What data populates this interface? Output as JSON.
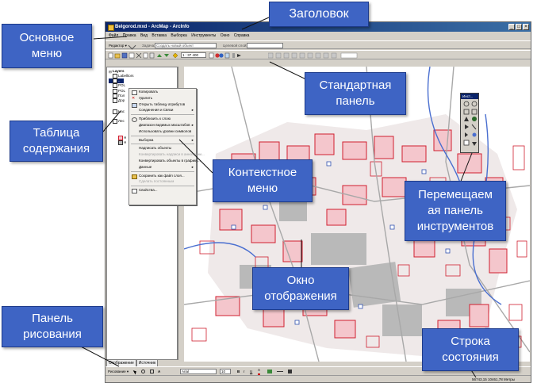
{
  "window": {
    "title": "Belgorod.mxd - ArcMap - ArcInfo",
    "controls": [
      "_",
      "□",
      "×"
    ]
  },
  "menu": [
    "Файл",
    "Правка",
    "Вид",
    "Вставка",
    "Выборка",
    "Инструменты",
    "Окно",
    "Справка"
  ],
  "editor_toolbar": {
    "editor_label": "Редактор ▾",
    "task_label": "Задача:",
    "task_value": "Создать новый объект",
    "target_label": "Целевой слой:"
  },
  "standard_toolbar": {
    "scale": "1 : 37 400"
  },
  "toc": {
    "root_label": "Layers",
    "items": [
      "Labelltors",
      "..",
      "POL",
      "POL",
      "Пол",
      "Дор",
      "Нас",
      "Лес",
      "Н",
      "Н"
    ],
    "tabs": [
      "Отображение",
      "Источник"
    ]
  },
  "context_menu": {
    "items": [
      {
        "label": "Копировать",
        "enabled": true
      },
      {
        "label": "Удалить",
        "enabled": true
      },
      {
        "label": "Открыть таблицу атрибутов",
        "enabled": true
      },
      {
        "label": "Соединения и Связи",
        "enabled": true,
        "submenu": true
      },
      {
        "label": "Приблизить к слою",
        "enabled": true
      },
      {
        "label": "Диапазон видимых масштабов",
        "enabled": true,
        "submenu": true
      },
      {
        "label": "Использовать уровни символов",
        "enabled": true
      },
      {
        "label": "Выборка",
        "enabled": true,
        "submenu": true
      },
      {
        "label": "Надписать объекты",
        "enabled": true
      },
      {
        "label": "Конвертировать надписи в аннотации...",
        "enabled": false
      },
      {
        "label": "Конвертировать объекты в графику...",
        "enabled": true
      },
      {
        "label": "Данные",
        "enabled": true,
        "submenu": true
      },
      {
        "label": "Сохранить как файл слоя...",
        "enabled": true
      },
      {
        "label": "Сделать постоянным",
        "enabled": false
      },
      {
        "label": "Свойства...",
        "enabled": true
      }
    ]
  },
  "tools_palette": {
    "title": "Инст..."
  },
  "drawing_toolbar": {
    "draw_label": "Рисование ▾",
    "font": "Arial",
    "font_size": "10",
    "bold": "B",
    "italic": "I",
    "underline": "U",
    "font_color": "A"
  },
  "status_bar": {
    "coordinates": "56743,15  10461,78 Метры"
  },
  "callouts": {
    "title": [
      "Заголовок"
    ],
    "main_menu": [
      "Основное",
      "меню"
    ],
    "standard_panel": [
      "Стандартная",
      "панель"
    ],
    "toc": [
      "Таблица",
      "содержания"
    ],
    "context_menu": [
      "Контекстное",
      "меню"
    ],
    "floating_panel": [
      "Перемещаем",
      "ая панель",
      "инструментов"
    ],
    "map_window": [
      "Окно",
      "отображения"
    ],
    "draw_panel": [
      "Панель",
      "рисования"
    ],
    "status_bar": [
      "Строка",
      "состояния"
    ]
  },
  "colors": {
    "callout_fill": "#3e64c4",
    "callout_text": "#ffffff",
    "title_bar": "#0a246a",
    "parcel_red": "#d02030",
    "parcel_pink": "#f4c6cc",
    "road_gray": "#a8a8a8",
    "river_blue": "#4a6fd0",
    "map_grey": "#b9b9b9"
  }
}
